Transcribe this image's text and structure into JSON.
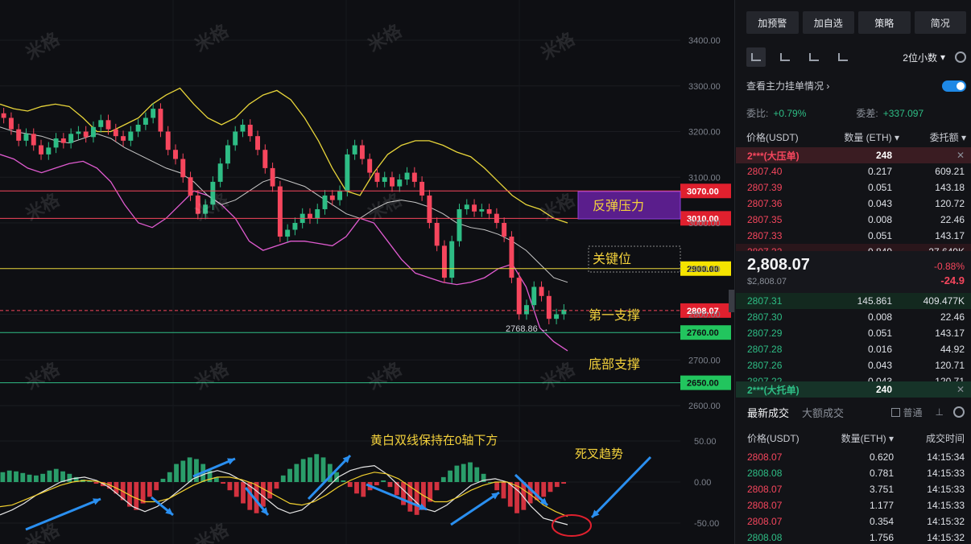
{
  "colors": {
    "up": "#2ebd85",
    "down": "#f6465d",
    "upper_band": "#e8d53a",
    "lower_band": "#e05bd0",
    "mid_band": "#c8c8c8",
    "accent": "#1e88e5"
  },
  "chart_data": {
    "type": "candlestick",
    "yaxis_ticks": [
      "3400.00",
      "3300.00",
      "3200.00",
      "3100.00",
      "3000.00",
      "2900.00",
      "2800.00",
      "2700.00",
      "2600.00"
    ],
    "ylim": [
      2560,
      3465
    ],
    "levels": [
      {
        "value": 3070,
        "label": "3070.00",
        "color": "#f6465d",
        "annotation": "反弹压力"
      },
      {
        "value": 3010,
        "label": "3010.00",
        "color": "#f6465d",
        "annotation": ""
      },
      {
        "value": 2900,
        "label": "2900.00",
        "color": "#e8d53a",
        "annotation": "关键位"
      },
      {
        "value": 2808.07,
        "label": "2808.07",
        "color": "#f6465d",
        "annotation": "第一支撑"
      },
      {
        "value": 2760,
        "label": "2760.00",
        "color": "#2ebd85",
        "annotation": ""
      },
      {
        "value": 2650,
        "label": "2650.00",
        "color": "#2ebd85",
        "annotation": "底部支撑"
      }
    ],
    "low_marker": "2768.86",
    "closes": [
      3230,
      3205,
      3180,
      3195,
      3170,
      3150,
      3165,
      3185,
      3175,
      3195,
      3200,
      3188,
      3210,
      3225,
      3205,
      3190,
      3180,
      3200,
      3215,
      3230,
      3250,
      3200,
      3160,
      3140,
      3100,
      3060,
      3020,
      3040,
      3090,
      3130,
      3170,
      3200,
      3215,
      3190,
      3160,
      3120,
      3080,
      2970,
      2985,
      3000,
      3020,
      3010,
      3030,
      3060,
      3050,
      3070,
      3150,
      3170,
      3140,
      3110,
      3090,
      3100,
      3080,
      3095,
      3110,
      3090,
      3060,
      3000,
      2950,
      2880,
      2960,
      3030,
      3040,
      3025,
      3030,
      3020,
      3000,
      2970,
      2880,
      2800,
      2820,
      2860,
      2840,
      2790,
      2800,
      2810
    ],
    "upper_band": [
      3260,
      3250,
      3245,
      3255,
      3260,
      3255,
      3230,
      3200,
      3200,
      3215,
      3230,
      3260,
      3280,
      3295,
      3260,
      3230,
      3215,
      3230,
      3260,
      3280,
      3290,
      3270,
      3230,
      3180,
      3120,
      3070,
      3060,
      3110,
      3150,
      3170,
      3180,
      3180,
      3170,
      3155,
      3145,
      3120,
      3090,
      3060,
      3040,
      3030,
      3010,
      3000
    ],
    "lower_band": [
      3150,
      3140,
      3120,
      3110,
      3120,
      3130,
      3135,
      3120,
      3090,
      3040,
      3000,
      2990,
      3010,
      3040,
      3070,
      3060,
      3040,
      3010,
      2960,
      2940,
      2950,
      2960,
      2960,
      2955,
      2950,
      2970,
      3010,
      3000,
      2960,
      2920,
      2890,
      2880,
      2870,
      2865,
      2870,
      2880,
      2900,
      2910,
      2860,
      2770,
      2740,
      2720
    ],
    "mid_band": [
      3210,
      3200,
      3195,
      3190,
      3180,
      3175,
      3185,
      3195,
      3185,
      3165,
      3150,
      3135,
      3120,
      3110,
      3090,
      3060,
      3040,
      3050,
      3070,
      3090,
      3100,
      3090,
      3080,
      3060,
      3040,
      3020,
      3010,
      3030,
      3045,
      3050,
      3045,
      3035,
      3020,
      3000,
      2990,
      2985,
      2975,
      2960,
      2940,
      2910,
      2880,
      2870
    ],
    "macd": {
      "yaxis_ticks": [
        "50.00",
        "0.00",
        "-50.00"
      ],
      "ylim": [
        -60,
        60
      ],
      "histogram": [
        12,
        14,
        13,
        11,
        9,
        8,
        10,
        14,
        16,
        13,
        10,
        6,
        3,
        1,
        -2,
        -5,
        -8,
        -14,
        -22,
        -30,
        -34,
        -26,
        -18,
        -10,
        4,
        12,
        22,
        26,
        30,
        28,
        22,
        14,
        6,
        -2,
        -10,
        -18,
        -26,
        -34,
        -38,
        -30,
        -20,
        -8,
        8,
        16,
        22,
        28,
        30,
        34,
        30,
        22,
        12,
        2,
        -6,
        -14,
        -18,
        -10,
        -4,
        2,
        -6,
        -16,
        -28,
        -36,
        -40,
        -34,
        -24,
        -10,
        6,
        14,
        20,
        22,
        24,
        18,
        10,
        0,
        -10,
        -20,
        -30,
        -38,
        -34,
        -26,
        -22,
        -18,
        -12,
        -6,
        -2
      ],
      "dif": [
        -40,
        -34,
        -26,
        -16,
        -8,
        0,
        4,
        6,
        2,
        -6,
        -18,
        -30,
        -36,
        -30,
        -20,
        -8,
        4,
        10,
        14,
        10,
        2,
        -8,
        -20,
        -32,
        -38,
        -34,
        -22,
        -8,
        6,
        14,
        18,
        20,
        10,
        -4,
        -18,
        -32,
        -36,
        -28,
        -16,
        -4,
        2,
        4,
        0,
        -12,
        -30,
        -44,
        -48,
        -52
      ],
      "dea": [
        -30,
        -28,
        -22,
        -16,
        -10,
        -4,
        0,
        2,
        1,
        -3,
        -10,
        -18,
        -24,
        -24,
        -20,
        -12,
        -4,
        2,
        6,
        6,
        3,
        -2,
        -10,
        -18,
        -26,
        -28,
        -24,
        -16,
        -6,
        2,
        8,
        12,
        10,
        4,
        -6,
        -16,
        -24,
        -24,
        -18,
        -10,
        -4,
        0,
        0,
        -6,
        -16,
        -28,
        -36,
        -42
      ]
    }
  },
  "annotations": {
    "rebound_pressure": "反弹压力",
    "key_level": "关键位",
    "first_support": "第一支撑",
    "bottom_support": "底部支撑",
    "macd_note": "黄白双线保持在0轴下方",
    "death_cross": "死叉趋势",
    "low_value": "2768.86 →"
  },
  "watermark": "米格",
  "panel": {
    "buttons": [
      "加预警",
      "加自选",
      "策略",
      "简况"
    ],
    "decimals": "2位小数",
    "main_orders": "查看主力挂单情况",
    "ratio_label": "委比:",
    "ratio_value": "+0.79%",
    "diff_label": "委差:",
    "diff_value": "+337.097",
    "col_price": "价格(USDT)",
    "col_qty": "数量 (ETH)",
    "col_amount": "委托额",
    "big_sell_label": "2***(大压单)",
    "big_sell_value": "248",
    "asks": [
      {
        "price": "2807.40",
        "qty": "0.217",
        "amount": "609.21"
      },
      {
        "price": "2807.39",
        "qty": "0.051",
        "amount": "143.18"
      },
      {
        "price": "2807.36",
        "qty": "0.043",
        "amount": "120.72"
      },
      {
        "price": "2807.35",
        "qty": "0.008",
        "amount": "22.46"
      },
      {
        "price": "2807.33",
        "qty": "0.051",
        "amount": "143.17"
      },
      {
        "price": "2807.32",
        "qty": "9.849",
        "amount": "27.649K"
      }
    ],
    "last_price": "2,808.07",
    "last_price_sub": "$2,808.07",
    "change_pct": "-0.88%",
    "change_abs": "-24.9",
    "bids": [
      {
        "price": "2807.31",
        "qty": "145.861",
        "amount": "409.477K"
      },
      {
        "price": "2807.30",
        "qty": "0.008",
        "amount": "22.46"
      },
      {
        "price": "2807.29",
        "qty": "0.051",
        "amount": "143.17"
      },
      {
        "price": "2807.28",
        "qty": "0.016",
        "amount": "44.92"
      },
      {
        "price": "2807.26",
        "qty": "0.043",
        "amount": "120.71"
      },
      {
        "price": "2807.22",
        "qty": "0.043",
        "amount": "120.71"
      }
    ],
    "big_buy_label": "2***(大托单)",
    "big_buy_value": "240",
    "tab_latest": "最新成交",
    "tab_large": "大额成交",
    "normal_label": "普通",
    "t_col_price": "价格(USDT)",
    "t_col_qty": "数量(ETH)",
    "t_col_time": "成交时间",
    "trades": [
      {
        "price": "2808.07",
        "qty": "0.620",
        "time": "14:15:34",
        "side": "down"
      },
      {
        "price": "2808.08",
        "qty": "0.781",
        "time": "14:15:33",
        "side": "up"
      },
      {
        "price": "2808.07",
        "qty": "3.751",
        "time": "14:15:33",
        "side": "down"
      },
      {
        "price": "2808.07",
        "qty": "1.177",
        "time": "14:15:33",
        "side": "down"
      },
      {
        "price": "2808.07",
        "qty": "0.354",
        "time": "14:15:32",
        "side": "down"
      },
      {
        "price": "2808.08",
        "qty": "1.756",
        "time": "14:15:32",
        "side": "up"
      }
    ]
  }
}
